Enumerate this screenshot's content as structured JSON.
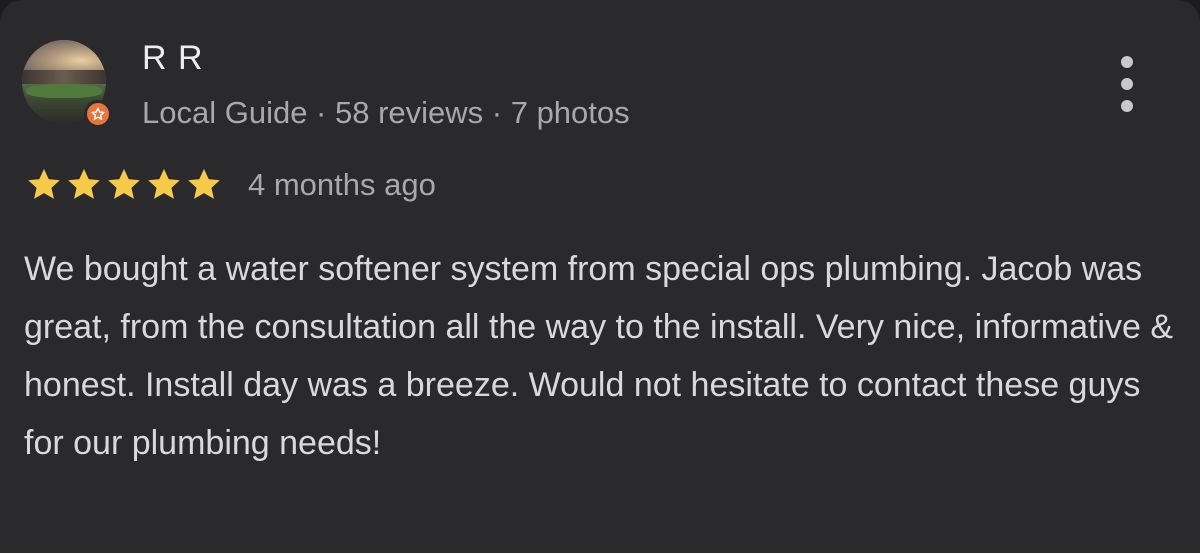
{
  "review": {
    "author_name": "R R",
    "author_meta": "Local Guide · 58 reviews · 7 photos",
    "rating": 5,
    "rating_max": 5,
    "time_ago": "4 months ago",
    "text": "We bought a water softener system from special ops plumbing. Jacob was great, from the consultation all the way to the install. Very nice, informative & honest. Install day was a breeze. Would not hesitate to contact these guys for our plumbing needs!"
  },
  "icons": {
    "avatar": "stadium-photo-avatar",
    "badge": "local-guide-star-icon",
    "menu": "more-vert-icon",
    "star": "star-icon"
  },
  "colors": {
    "card_background": "#2a2a2c",
    "star_color": "#f5c94a",
    "badge_color": "#e8753a",
    "secondary_text": "#a8a8ad"
  }
}
